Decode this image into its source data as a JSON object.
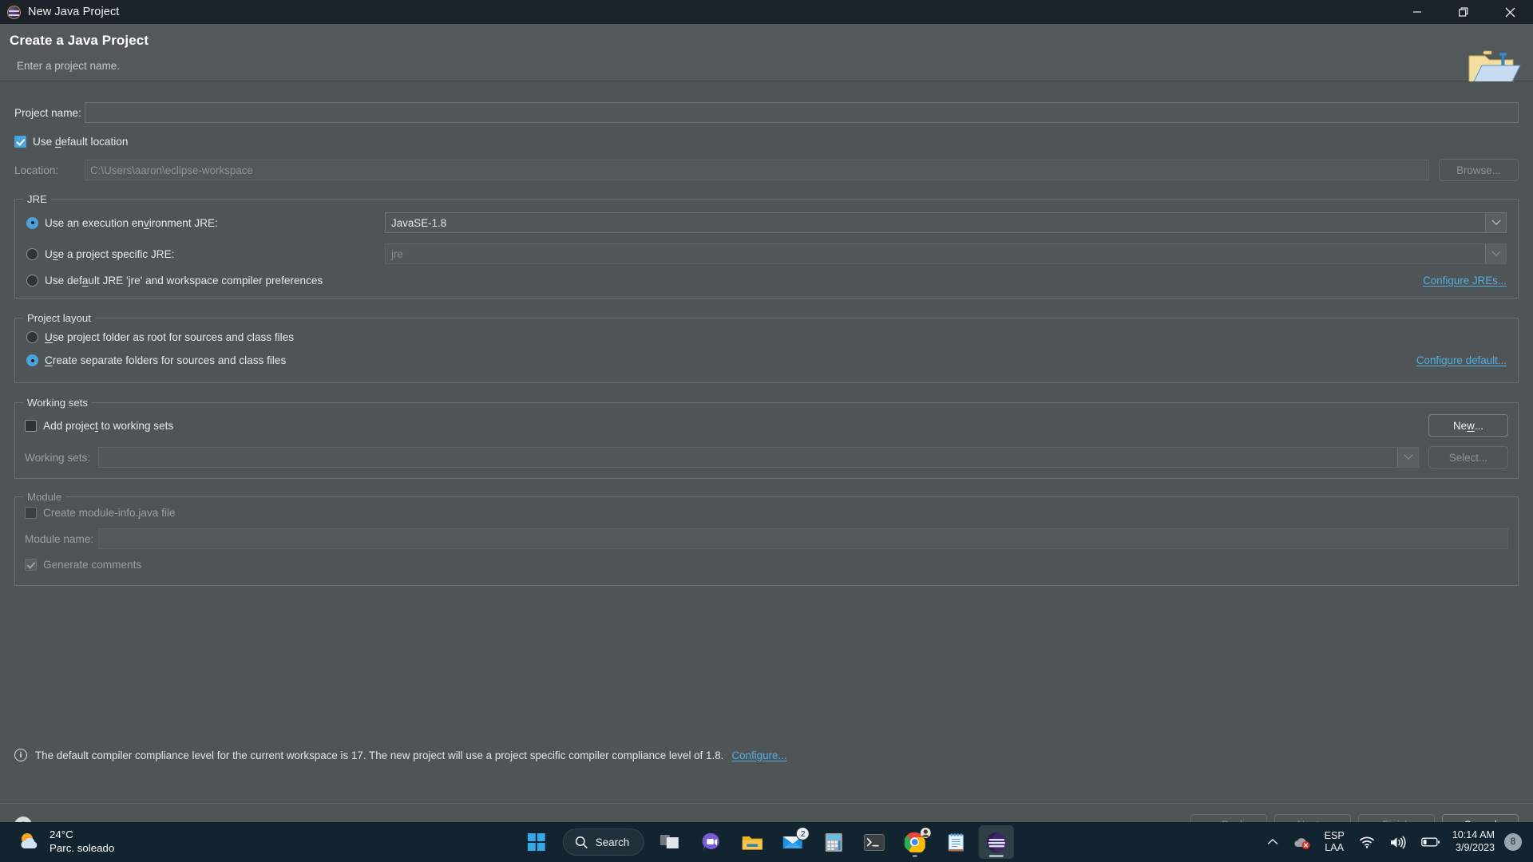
{
  "window": {
    "title": "New Java Project",
    "app_icon": "eclipse-icon",
    "minimize_label": "—",
    "restore_label": "restore-icon",
    "close_label": "✕"
  },
  "header": {
    "title": "Create a Java Project",
    "subtitle": "Enter a project name.",
    "banner_icon": "java-project-folder-icon"
  },
  "form": {
    "project_name_label": "Project name:",
    "project_name_value": "",
    "use_default_location_label": "Use default location",
    "use_default_location_checked": true,
    "location_label": "Location:",
    "location_value": "C:\\Users\\aaron\\eclipse-workspace",
    "browse_label": "Browse...",
    "browse_enabled": false
  },
  "jre": {
    "group_title": "JRE",
    "option_execution_env": "Use an execution environment JRE:",
    "option_project_specific": "Use a project specific JRE:",
    "option_default_jre": "Use default JRE 'jre' and workspace compiler preferences",
    "selected": "execution_env",
    "execution_env_value": "JavaSE-1.8",
    "project_specific_value": "jre",
    "configure_jres_link": "Configure JREs..."
  },
  "project_layout": {
    "group_title": "Project layout",
    "option_project_folder_root": "Use project folder as root for sources and class files",
    "option_separate_folders": "Create separate folders for sources and class files",
    "selected": "separate_folders",
    "configure_default_link": "Configure default..."
  },
  "working_sets": {
    "group_title": "Working sets",
    "add_project_label": "Add project to working sets",
    "add_project_checked": false,
    "working_sets_label": "Working sets:",
    "working_sets_value": "",
    "new_label": "New...",
    "new_enabled": true,
    "select_label": "Select...",
    "select_enabled": false
  },
  "module": {
    "group_title": "Module",
    "create_module_info_label": "Create module-info.java file",
    "create_module_info_checked": false,
    "module_name_label": "Module name:",
    "module_name_value": "",
    "generate_comments_label": "Generate comments",
    "generate_comments_checked": true,
    "enabled": false
  },
  "info": {
    "icon": "info-icon",
    "message": "The default compiler compliance level for the current workspace is 17. The new project will use a project specific compiler compliance level of 1.8.",
    "link": "Configure..."
  },
  "footer": {
    "help_label": "?",
    "buttons": [
      {
        "label": "< Back",
        "enabled": false,
        "name": "back-button"
      },
      {
        "label": "Next >",
        "enabled": false,
        "name": "next-button"
      },
      {
        "label": "Finish",
        "enabled": false,
        "name": "finish-button"
      },
      {
        "label": "Cancel",
        "enabled": true,
        "name": "cancel-button"
      }
    ]
  },
  "taskbar": {
    "weather": {
      "temperature": "24°C",
      "description": "Parc. soleado",
      "icon": "sun-behind-cloud-icon"
    },
    "search_placeholder": "Search",
    "items": [
      {
        "name": "start-button",
        "icon": "windows-logo-icon",
        "badge": "",
        "running": false,
        "active": false
      },
      {
        "name": "task-view-button",
        "icon": "task-view-icon",
        "badge": "",
        "running": false,
        "active": false
      },
      {
        "name": "chat-button",
        "icon": "chat-video-icon",
        "badge": "",
        "running": false,
        "active": false
      },
      {
        "name": "file-explorer-button",
        "icon": "folder-icon",
        "badge": "",
        "running": false,
        "active": false
      },
      {
        "name": "mail-button",
        "icon": "mail-icon",
        "badge": "2",
        "running": false,
        "active": false
      },
      {
        "name": "calculator-button",
        "icon": "calculator-icon",
        "badge": "",
        "running": false,
        "active": false
      },
      {
        "name": "terminal-button",
        "icon": "terminal-icon",
        "badge": "",
        "running": false,
        "active": false
      },
      {
        "name": "chrome-button",
        "icon": "chrome-icon",
        "badge": "",
        "running": true,
        "active": false
      },
      {
        "name": "notepad-button",
        "icon": "notepad-icon",
        "badge": "",
        "running": false,
        "active": false
      },
      {
        "name": "eclipse-button",
        "icon": "eclipse-icon",
        "badge": "",
        "running": true,
        "active": true
      }
    ],
    "tray": {
      "overflow_icon": "chevron-up-icon",
      "onedrive_icon": "onedrive-error-icon",
      "language_line1": "ESP",
      "language_line2": "LAA",
      "wifi_icon": "wifi-icon",
      "volume_icon": "volume-icon",
      "battery_icon": "battery-icon",
      "time": "10:14 AM",
      "date": "3/9/2023",
      "notification_count": "8"
    }
  },
  "colors": {
    "accent": "#4aa3dd",
    "link": "#55aee0",
    "dialog_bg": "#4f5457",
    "titlebar_bg": "#1b2229",
    "taskbar_bg": "#12242f"
  }
}
